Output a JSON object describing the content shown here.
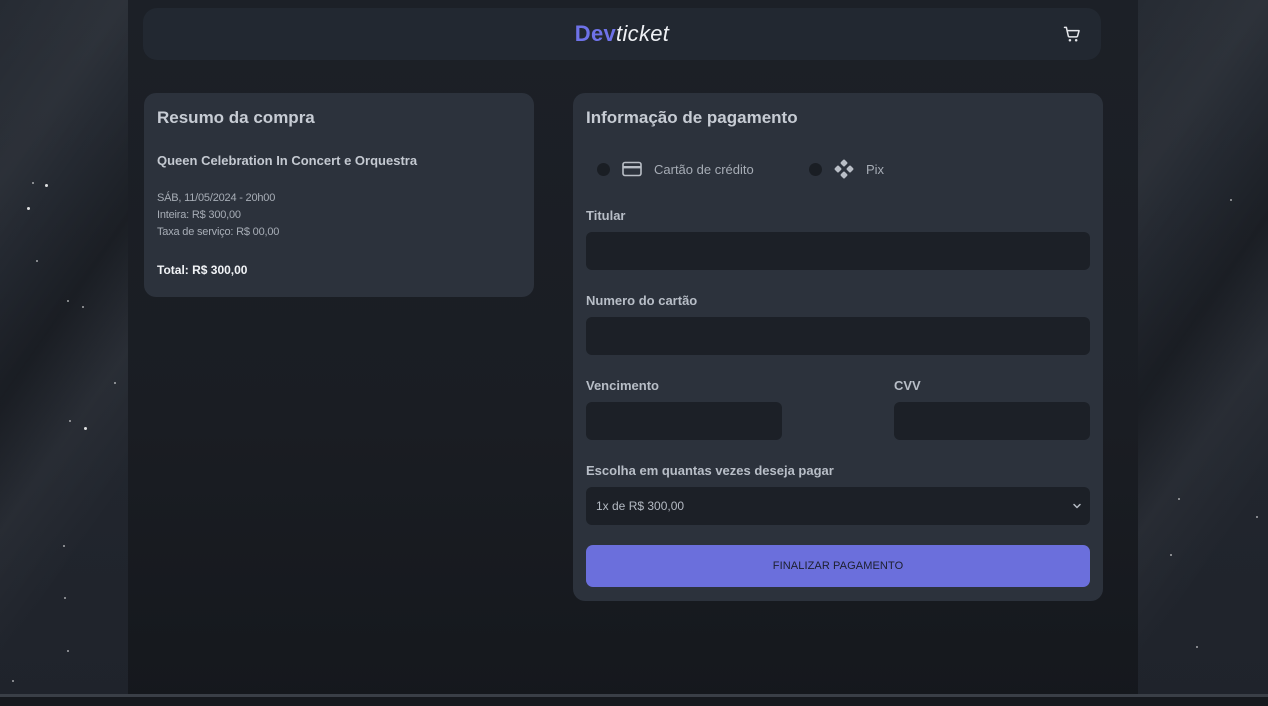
{
  "header": {
    "logo_part1": "Dev",
    "logo_part2": "ticket",
    "cart_icon": "cart-icon"
  },
  "summary": {
    "title": "Resumo da compra",
    "event_name": "Queen Celebration In Concert e Orquestra",
    "date_line": "SÁB, 11/05/2024 - 20h00",
    "ticket_line": "Inteira: R$ 300,00",
    "fee_line": "Taxa de serviço: R$ 00,00",
    "total": "Total: R$ 300,00"
  },
  "payment": {
    "title": "Informação de pagamento",
    "methods": [
      {
        "label": "Cartão de crédito",
        "icon": "credit-card-icon",
        "selected": false
      },
      {
        "label": "Pix",
        "icon": "pix-icon",
        "selected": false
      }
    ],
    "fields": {
      "holder_label": "Titular",
      "holder_value": "",
      "card_number_label": "Numero do cartão",
      "card_number_value": "",
      "expiry_label": "Vencimento",
      "expiry_value": "",
      "cvv_label": "CVV",
      "cvv_value": ""
    },
    "installments_label": "Escolha em quantas vezes deseja pagar",
    "installments_selected": "1x de R$ 300,00",
    "submit_label": "FINALIZAR PAGAMENTO"
  },
  "colors": {
    "accent": "#6b6fdc",
    "logo_accent": "#6e72e8",
    "card_bg": "#2c323c",
    "input_bg": "#1c2027",
    "page_bg": "#1a1d23"
  }
}
